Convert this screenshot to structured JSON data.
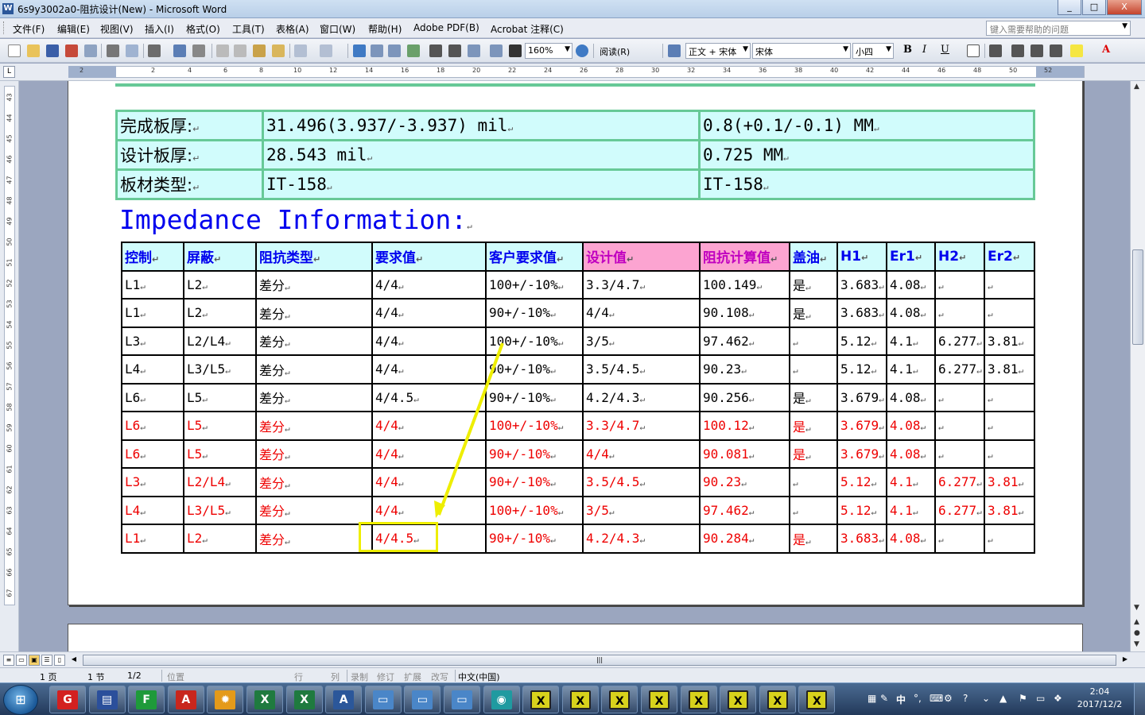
{
  "window": {
    "title": "6s9y3002a0-阻抗设计(New) - Microsoft Word",
    "app_icon": "W",
    "controls": [
      "_",
      "□",
      "X"
    ]
  },
  "menu": {
    "items": [
      "文件(F)",
      "编辑(E)",
      "视图(V)",
      "插入(I)",
      "格式(O)",
      "工具(T)",
      "表格(A)",
      "窗口(W)",
      "帮助(H)",
      "Adobe PDF(B)",
      "Acrobat 注释(C)"
    ],
    "help_placeholder": "键入需要帮助的问题"
  },
  "toolbar": {
    "zoom": "160%",
    "read_button": "阅读(R)",
    "style": "正文 + 宋体",
    "font": "宋体",
    "size": "小四",
    "bold": "B",
    "italic": "I",
    "underline": "U",
    "font_color": "A"
  },
  "ruler": {
    "corner": "L",
    "numbers": [
      "2",
      "2",
      "4",
      "6",
      "8",
      "10",
      "12",
      "14",
      "16",
      "18",
      "20",
      "22",
      "24",
      "26",
      "28",
      "30",
      "32",
      "34",
      "36",
      "38",
      "40",
      "42",
      "44",
      "46",
      "48",
      "50",
      "52"
    ],
    "vertical_numbers": [
      "43",
      "44",
      "45",
      "46",
      "47",
      "48",
      "49",
      "50",
      "51",
      "52",
      "53",
      "54",
      "55",
      "56",
      "57",
      "58",
      "59",
      "60",
      "61",
      "62",
      "63",
      "64",
      "65",
      "66",
      "67"
    ]
  },
  "document": {
    "info_rows": [
      {
        "label": "完成板厚:",
        "mil": "31.496(3.937/-3.937) mil",
        "mm": "0.8(+0.1/-0.1) MM"
      },
      {
        "label": "设计板厚:",
        "mil": "28.543 mil",
        "mm": "0.725 MM"
      },
      {
        "label": "板材类型:",
        "mil": "IT-158",
        "mm": "IT-158"
      }
    ],
    "heading": "Impedance Information:",
    "headers": [
      "控制",
      "屏蔽",
      "阻抗类型",
      "要求值",
      "客户要求值",
      "设计值",
      "阻抗计算值",
      "盖油",
      "H1",
      "Er1",
      "H2",
      "Er2"
    ],
    "rows": [
      {
        "style": "black",
        "cells": [
          "L1",
          "L2",
          "差分",
          "4/4",
          "100+/-10%",
          "3.3/4.7",
          "100.149",
          "是",
          "3.683",
          "4.08",
          "",
          ""
        ]
      },
      {
        "style": "black",
        "cells": [
          "L1",
          "L2",
          "差分",
          "4/4",
          "90+/-10%",
          "4/4",
          "90.108",
          "是",
          "3.683",
          "4.08",
          "",
          ""
        ]
      },
      {
        "style": "black",
        "cells": [
          "L3",
          "L2/L4",
          "差分",
          "4/4",
          "100+/-10%",
          "3/5",
          "97.462",
          "",
          "5.12",
          "4.1",
          "6.277",
          "3.81"
        ]
      },
      {
        "style": "black",
        "cells": [
          "L4",
          "L3/L5",
          "差分",
          "4/4",
          "90+/-10%",
          "3.5/4.5",
          "90.23",
          "",
          "5.12",
          "4.1",
          "6.277",
          "3.81"
        ]
      },
      {
        "style": "black",
        "cells": [
          "L6",
          "L5",
          "差分",
          "4/4.5",
          "90+/-10%",
          "4.2/4.3",
          "90.256",
          "是",
          "3.679",
          "4.08",
          "",
          ""
        ]
      },
      {
        "style": "red",
        "cells": [
          "L6",
          "L5",
          "差分",
          "4/4",
          "100+/-10%",
          "3.3/4.7",
          "100.12",
          "是",
          "3.679",
          "4.08",
          "",
          ""
        ]
      },
      {
        "style": "red",
        "cells": [
          "L6",
          "L5",
          "差分",
          "4/4",
          "90+/-10%",
          "4/4",
          "90.081",
          "是",
          "3.679",
          "4.08",
          "",
          ""
        ]
      },
      {
        "style": "red",
        "cells": [
          "L3",
          "L2/L4",
          "差分",
          "4/4",
          "90+/-10%",
          "3.5/4.5",
          "90.23",
          "",
          "5.12",
          "4.1",
          "6.277",
          "3.81"
        ]
      },
      {
        "style": "red",
        "cells": [
          "L4",
          "L3/L5",
          "差分",
          "4/4",
          "100+/-10%",
          "3/5",
          "97.462",
          "",
          "5.12",
          "4.1",
          "6.277",
          "3.81"
        ]
      },
      {
        "style": "red",
        "cells": [
          "L1",
          "L2",
          "差分",
          "4/4.5",
          "90+/-10%",
          "4.2/4.3",
          "90.284",
          "是",
          "3.683",
          "4.08",
          "",
          ""
        ]
      }
    ],
    "cell_end_mark": "↵",
    "annotation_color": "#eeee00"
  },
  "status": {
    "page": "1 页",
    "section": "1 节",
    "pages": "1/2",
    "position": "位置",
    "line": "行",
    "column": "列",
    "record": "录制",
    "revise": "修订",
    "extend": "扩展",
    "overtype": "改写",
    "language": "中文(中国)"
  },
  "taskbar": {
    "start_label": "⊞",
    "apps": [
      {
        "name": "app-g",
        "glyph": "G",
        "color": "#d32020"
      },
      {
        "name": "save",
        "glyph": "▤",
        "color": "#2b4f9b"
      },
      {
        "name": "app-f",
        "glyph": "F",
        "color": "#1e9a3a"
      },
      {
        "name": "adobe",
        "glyph": "A",
        "color": "#c8261d"
      },
      {
        "name": "shell",
        "glyph": "✹",
        "color": "#e49a1a"
      },
      {
        "name": "excel-1",
        "glyph": "X",
        "color": "#1f7a3f"
      },
      {
        "name": "excel-2",
        "glyph": "X",
        "color": "#1f7a3f"
      },
      {
        "name": "word",
        "glyph": "A",
        "color": "#2b579a"
      },
      {
        "name": "window-1",
        "glyph": "▭",
        "color": "#4a86c8"
      },
      {
        "name": "window-2",
        "glyph": "▭",
        "color": "#4a86c8"
      },
      {
        "name": "window-3",
        "glyph": "▭",
        "color": "#4a86c8"
      },
      {
        "name": "eye",
        "glyph": "◉",
        "color": "#1f9aa0"
      },
      {
        "name": "x-1",
        "glyph": "X",
        "color": "#d8d21c"
      },
      {
        "name": "x-2",
        "glyph": "X",
        "color": "#d8d21c"
      },
      {
        "name": "x-3",
        "glyph": "X",
        "color": "#d8d21c"
      },
      {
        "name": "x-4",
        "glyph": "X",
        "color": "#d8d21c"
      },
      {
        "name": "x-5",
        "glyph": "X",
        "color": "#d8d21c"
      },
      {
        "name": "x-6",
        "glyph": "X",
        "color": "#d8d21c"
      },
      {
        "name": "x-7",
        "glyph": "X",
        "color": "#d8d21c"
      },
      {
        "name": "x-8",
        "glyph": "X",
        "color": "#d8d21c"
      }
    ],
    "tray_ime": "中",
    "time": "2:04",
    "date": "2017/12/2"
  }
}
